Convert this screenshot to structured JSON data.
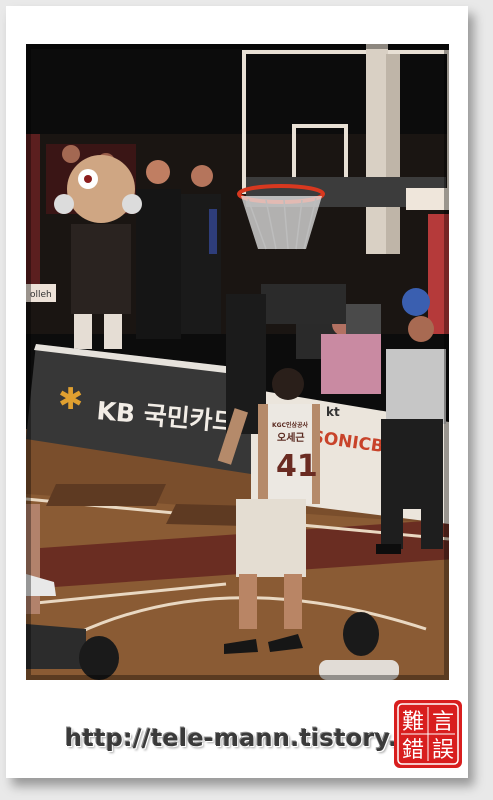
{
  "photo": {
    "sponsor_banner": "KB 국민카드",
    "jersey_team": "KGC인삼공사",
    "jersey_name": "오세근",
    "jersey_number": "41",
    "banner_brand": "kt",
    "banner_word": "SONICBOOM",
    "scoreboard_sign": "olleh"
  },
  "caption": {
    "url": "http://tele-mann.tistory.com"
  },
  "seal": {
    "chars": [
      "難",
      "言",
      "錯",
      "誤"
    ],
    "color": "#d81e1e"
  }
}
